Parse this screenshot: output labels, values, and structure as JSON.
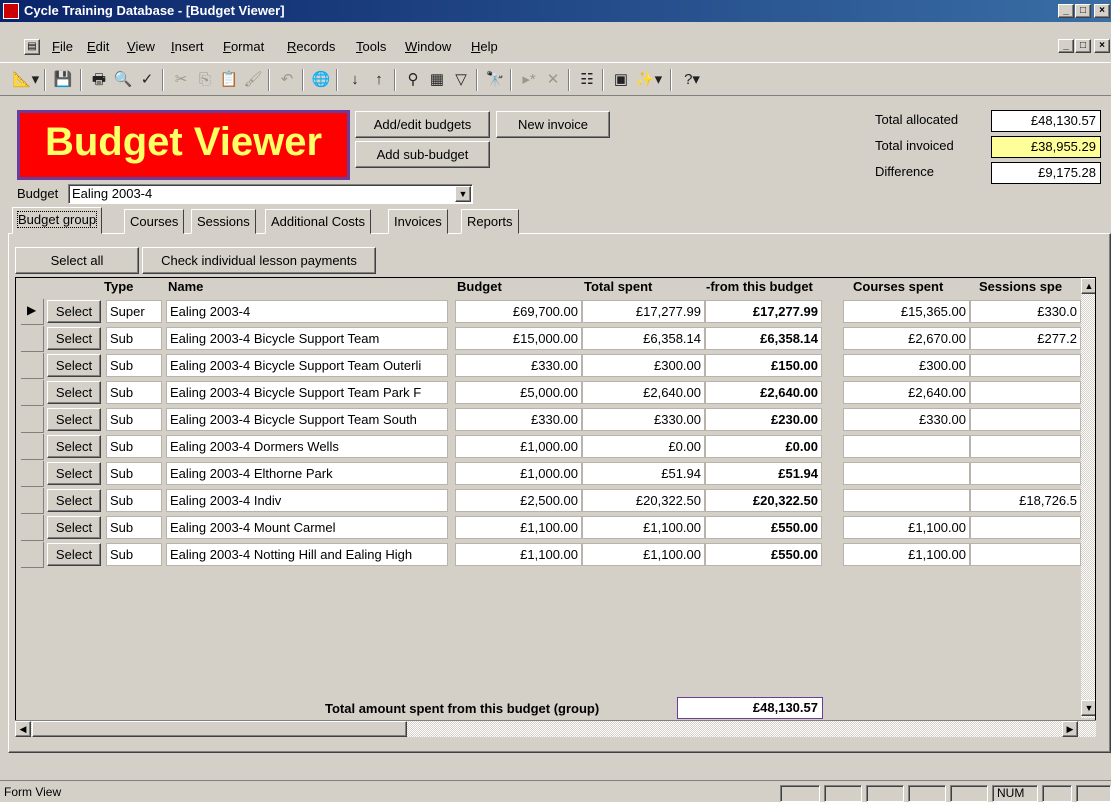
{
  "window": {
    "title": "Cycle Training Database - [Budget Viewer]",
    "min": "_",
    "max": "□",
    "close": "×"
  },
  "menu": [
    "File",
    "Edit",
    "View",
    "Insert",
    "Format",
    "Records",
    "Tools",
    "Window",
    "Help"
  ],
  "header": {
    "logo_text": "Budget Viewer",
    "add_edit_budgets": "Add/edit budgets",
    "add_sub_budget": "Add sub-budget",
    "new_invoice": "New invoice",
    "budget_label": "Budget",
    "budget_value": "Ealing 2003-4"
  },
  "totals": {
    "allocated_label": "Total allocated",
    "allocated": "£48,130.57",
    "invoiced_label": "Total invoiced",
    "invoiced": "£38,955.29",
    "difference_label": "Difference",
    "difference": "£9,175.28",
    "invoiced_bg": "#ffff99"
  },
  "tabs": [
    "Budget group",
    "Courses",
    "Sessions",
    "Additional Costs",
    "Invoices",
    "Reports"
  ],
  "actions": {
    "select_all": "Select all",
    "check_payments": "Check individual lesson payments"
  },
  "grid": {
    "columns": [
      "Type",
      "Name",
      "Budget",
      "Total spent",
      "-from this budget",
      "Courses spent",
      "Sessions spe"
    ],
    "select_label": "Select",
    "rows": [
      {
        "type": "Super",
        "name": "Ealing 2003-4",
        "budget": "£69,700.00",
        "spent": "£17,277.99",
        "from": "£17,277.99",
        "courses": "£15,365.00",
        "sessions": "£330.0"
      },
      {
        "type": "Sub",
        "name": "Ealing 2003-4 Bicycle Support Team",
        "budget": "£15,000.00",
        "spent": "£6,358.14",
        "from": "£6,358.14",
        "courses": "£2,670.00",
        "sessions": "£277.2"
      },
      {
        "type": "Sub",
        "name": "Ealing 2003-4 Bicycle Support Team Outerli",
        "budget": "£330.00",
        "spent": "£300.00",
        "from": "£150.00",
        "courses": "£300.00",
        "sessions": ""
      },
      {
        "type": "Sub",
        "name": "Ealing 2003-4 Bicycle Support Team Park F",
        "budget": "£5,000.00",
        "spent": "£2,640.00",
        "from": "£2,640.00",
        "courses": "£2,640.00",
        "sessions": ""
      },
      {
        "type": "Sub",
        "name": "Ealing 2003-4 Bicycle Support Team South",
        "budget": "£330.00",
        "spent": "£330.00",
        "from": "£230.00",
        "courses": "£330.00",
        "sessions": ""
      },
      {
        "type": "Sub",
        "name": "Ealing 2003-4 Dormers Wells",
        "budget": "£1,000.00",
        "spent": "£0.00",
        "from": "£0.00",
        "courses": "",
        "sessions": ""
      },
      {
        "type": "Sub",
        "name": "Ealing 2003-4 Elthorne Park",
        "budget": "£1,000.00",
        "spent": "£51.94",
        "from": "£51.94",
        "courses": "",
        "sessions": ""
      },
      {
        "type": "Sub",
        "name": "Ealing 2003-4 Indiv",
        "budget": "£2,500.00",
        "spent": "£20,322.50",
        "from": "£20,322.50",
        "courses": "",
        "sessions": "£18,726.5"
      },
      {
        "type": "Sub",
        "name": "Ealing 2003-4 Mount Carmel",
        "budget": "£1,100.00",
        "spent": "£1,100.00",
        "from": "£550.00",
        "courses": "£1,100.00",
        "sessions": ""
      },
      {
        "type": "Sub",
        "name": "Ealing 2003-4 Notting Hill and Ealing High",
        "budget": "£1,100.00",
        "spent": "£1,100.00",
        "from": "£550.00",
        "courses": "£1,100.00",
        "sessions": ""
      }
    ],
    "footer_label": "Total amount spent from this budget (group)",
    "footer_value": "£48,130.57"
  },
  "status": {
    "mode": "Form View",
    "num": "NUM"
  }
}
